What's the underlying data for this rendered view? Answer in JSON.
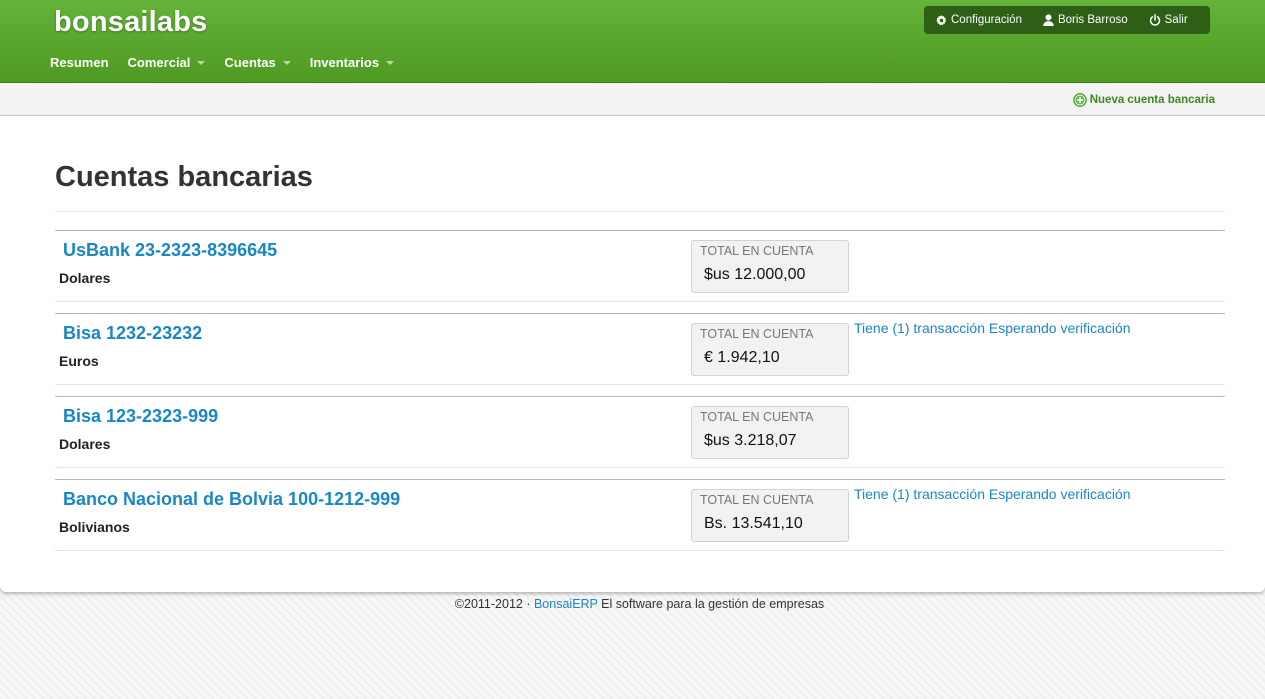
{
  "header": {
    "brand": "bonsailabs",
    "nav": [
      {
        "label": "Resumen"
      },
      {
        "label": "Comercial"
      },
      {
        "label": "Cuentas"
      },
      {
        "label": "Inventarios"
      }
    ],
    "user_menu": {
      "settings": "Configuración",
      "user": "Boris Barroso",
      "logout": "Salir"
    }
  },
  "toolbar": {
    "new_account": "Nueva cuenta bancaria"
  },
  "page": {
    "title": "Cuentas bancarias"
  },
  "accounts": [
    {
      "name": "UsBank 23-2323-8396645",
      "currency": "Dolares",
      "total_label": "TOTAL EN CUENTA",
      "total": "$us 12.000,00",
      "pending": ""
    },
    {
      "name": "Bisa 1232-23232",
      "currency": "Euros",
      "total_label": "TOTAL EN CUENTA",
      "total": "€ 1.942,10",
      "pending": "Tiene (1) transacción Esperando verificación"
    },
    {
      "name": "Bisa 123-2323-999",
      "currency": "Dolares",
      "total_label": "TOTAL EN CUENTA",
      "total": "$us 3.218,07",
      "pending": ""
    },
    {
      "name": "Banco Nacional de Bolvia 100-1212-999",
      "currency": "Bolivianos",
      "total_label": "TOTAL EN CUENTA",
      "total": "Bs. 13.541,10",
      "pending": "Tiene (1) transacción Esperando verificación"
    }
  ],
  "footer": {
    "copyright": "©2011-2012 · ",
    "link": "BonsaiERP",
    "tagline": " El software para la gestión de empresas"
  },
  "colors": {
    "header_green": "#5aa82f",
    "link_blue": "#1a87c5",
    "action_green": "#3a8a1f"
  }
}
